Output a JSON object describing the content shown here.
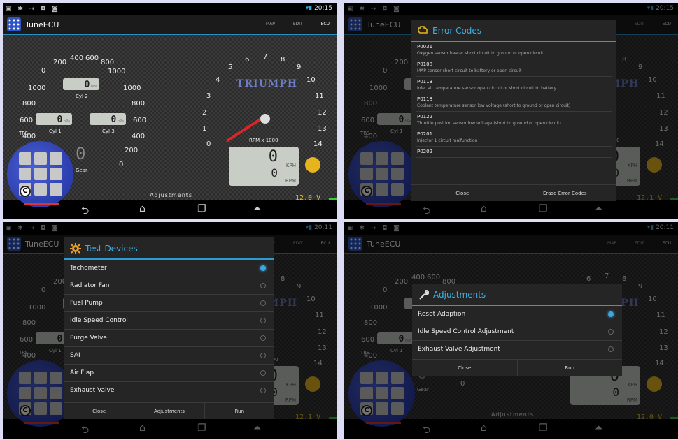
{
  "status_bar": {
    "icons": "▣ ✱ ⇢ ◘ ◙",
    "time_1": "20:15",
    "time_3": "20:11"
  },
  "app": {
    "title": "TuneECU",
    "tabs": [
      "MAP",
      "EDIT",
      "ECU"
    ]
  },
  "left_gauge": {
    "arc_labels": [
      "0",
      "200",
      "400",
      "600",
      "800",
      "1000"
    ],
    "left_labels": [
      "1000",
      "800",
      "600",
      "400",
      "200",
      "0"
    ],
    "right_labels": [
      "1000",
      "800",
      "600",
      "400",
      "200",
      "0"
    ],
    "lcd_unit": "hPa",
    "cyl_labels": [
      "Cyl 2",
      "Cyl 1",
      "Cyl 3"
    ],
    "gear_label": "Gear",
    "tps_label": "TPS"
  },
  "rpm_gauge": {
    "labels": [
      "0",
      "1",
      "2",
      "3",
      "4",
      "5",
      "6",
      "7",
      "8",
      "9",
      "10",
      "11",
      "12",
      "13",
      "14"
    ],
    "unit": "RPM x 1000",
    "brand": "TRIUMPH",
    "kph_unit": "KPH",
    "rpm_unit": "RPM",
    "speed_value": "0",
    "rpm_value": "0"
  },
  "footer": {
    "adjustments": "Adjustments",
    "voltage_1": "12.0 V",
    "voltage_2": "12.1 V",
    "voltage_3": "12.1 V",
    "voltage_4": "12.0 V"
  },
  "error_dialog": {
    "title": "Error Codes",
    "codes": [
      {
        "code": "P0031",
        "desc": "Oxygen sensor heater short circuit to ground or open circuit"
      },
      {
        "code": "P0108",
        "desc": "MAP sensor short circuit to battery or open circuit"
      },
      {
        "code": "P0113",
        "desc": "Inlet air temperature sensor open circuit or short circuit to battery"
      },
      {
        "code": "P0118",
        "desc": "Coolant temperature sensor low voltage (short to ground or open circuit)"
      },
      {
        "code": "P0122",
        "desc": "Throttle position sensor low voltage (short to ground or open circuit)"
      },
      {
        "code": "P0201",
        "desc": "Injector 1 circuit malfunction"
      },
      {
        "code": "P0202",
        "desc": ""
      }
    ],
    "close": "Close",
    "erase": "Erase Error Codes"
  },
  "test_dialog": {
    "title": "Test Devices",
    "items": [
      "Tachometer",
      "Radiator Fan",
      "Fuel Pump",
      "Idle Speed Control",
      "Purge Valve",
      "SAI",
      "Air Flap",
      "Exhaust Valve"
    ],
    "selected": "Tachometer",
    "close": "Close",
    "adjustments": "Adjustments",
    "run": "Run"
  },
  "adj_dialog": {
    "title": "Adjustments",
    "items": [
      "Reset Adaption",
      "Idle Speed Control Adjustment",
      "Exhaust Valve Adjustment"
    ],
    "selected": "Reset Adaption",
    "close": "Close",
    "run": "Run"
  },
  "colors": {
    "accent": "#2a9cd0",
    "logo": "#2f46b8",
    "needle": "#d8262a",
    "volt": "#ecc21c"
  },
  "icons": {
    "back": "back-icon",
    "home": "home-icon",
    "recents": "recents-icon",
    "menu": "menu-icon"
  }
}
